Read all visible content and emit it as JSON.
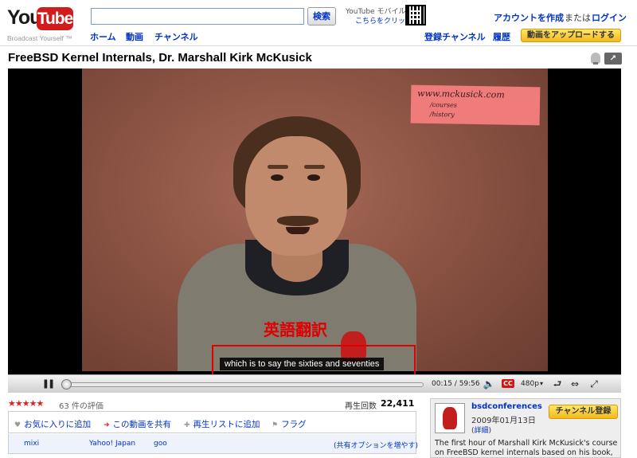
{
  "header": {
    "logo_you": "You",
    "logo_tube": "Tube",
    "tagline": "Broadcast Yourself ™",
    "search_placeholder": "",
    "search_button": "検索",
    "nav": [
      "ホーム",
      "動画",
      "チャンネル"
    ],
    "mobile_line1": "YouTube モバイル",
    "mobile_line2": "こちらをクリック",
    "create_account": "アカウントを作成",
    "or_text": "または",
    "login": "ログイン",
    "subscriptions": "登録チャンネル",
    "history": "履歴",
    "upload": "動画をアップロードする"
  },
  "video": {
    "title": "FreeBSD Kernel Internals, Dr. Marshall Kirk McKusick",
    "sign_line1": "www.mckusick.com",
    "sign_line2": "/courses",
    "sign_line3": "/history",
    "translate_label": "英語翻訳",
    "caption": "which is to say the sixties and seventies"
  },
  "player": {
    "time": "00:15 / 59:56",
    "cc": "CC",
    "quality": "480p",
    "progress": 0.004
  },
  "stats": {
    "stars": "★★★★★",
    "rating_count": "63 件の評価",
    "views_label": "再生回数",
    "views_count": "22,411"
  },
  "actions": {
    "favorite": "お気に入りに追加",
    "share": "この動画を共有",
    "playlist": "再生リストに追加",
    "flag": "フラグ"
  },
  "share": {
    "links": [
      "mixi",
      "Yahoo! Japan",
      "goo"
    ],
    "more": "(共有オプションを増やす)"
  },
  "channel": {
    "name": "bsdconferences",
    "date": "2009年01月13日",
    "details_open": "(",
    "details_link": "詳細",
    "details_close": ")",
    "subscribe": "チャンネル登録",
    "description": "The first hour of Marshall Kirk McKusick's course on FreeBSD kernel internals based on his book, The"
  }
}
